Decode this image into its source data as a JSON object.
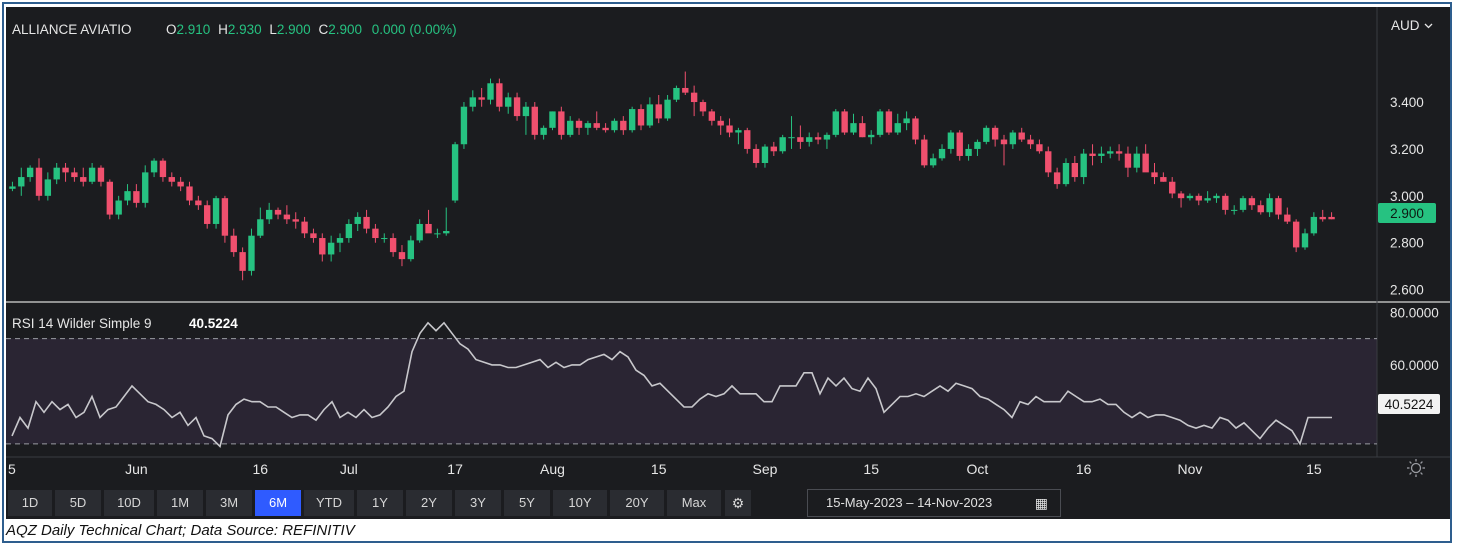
{
  "header": {
    "symbol": "ALLIANCE AVIATIO",
    "o_label": "O",
    "o_value": "2.910",
    "h_label": "H",
    "h_value": "2.930",
    "l_label": "L",
    "l_value": "2.900",
    "c_label": "C",
    "c_value": "2.900",
    "change": "0.000 (0.00%)",
    "currency": "AUD",
    "last_price_tag": "2.900"
  },
  "rsi_header": {
    "label": "RSI 14 Wilder Simple 9",
    "value": "40.5224",
    "last_tag": "40.5224"
  },
  "ranges": [
    "1D",
    "5D",
    "10D",
    "1M",
    "3M",
    "6M",
    "YTD",
    "1Y",
    "2Y",
    "3Y",
    "5Y",
    "10Y",
    "20Y",
    "Max"
  ],
  "active_range": "6M",
  "date_range": {
    "from": "15-May-2023",
    "sep": "–",
    "to": "14-Nov-2023"
  },
  "caption": "AQZ Daily Technical Chart; Data Source: REFINITIV",
  "colors": {
    "up": "#26c281",
    "down": "#f0506e",
    "rsi_line": "#c8c8cc",
    "bg": "#1b1c1f",
    "rsi_band": "#2a2533",
    "accent": "#2f5bff"
  },
  "icons": {
    "settings": "gear-icon",
    "calendar": "calendar-icon",
    "chevron": "chevron-down-icon",
    "chart_settings": "sun-gear-icon"
  },
  "chart_data": [
    {
      "type": "candlestick",
      "title": "ALLIANCE AVIATIO",
      "ylabel": "AUD",
      "ylim": [
        2.56,
        3.72
      ],
      "y_ticks": [
        "3.400",
        "3.200",
        "3.000",
        "2.800",
        "2.600"
      ],
      "x_ticks": [
        "5",
        "Jun",
        "16",
        "Jul",
        "17",
        "Aug",
        "15",
        "Sep",
        "15",
        "Oct",
        "16",
        "Nov",
        "15"
      ],
      "ohlc": [
        [
          3.03,
          3.06,
          3.02,
          3.04
        ],
        [
          3.04,
          3.12,
          3.0,
          3.08
        ],
        [
          3.08,
          3.13,
          3.06,
          3.12
        ],
        [
          3.12,
          3.16,
          2.98,
          3.0
        ],
        [
          3.0,
          3.1,
          2.98,
          3.07
        ],
        [
          3.07,
          3.14,
          3.05,
          3.12
        ],
        [
          3.12,
          3.14,
          3.06,
          3.1
        ],
        [
          3.1,
          3.12,
          3.06,
          3.08
        ],
        [
          3.08,
          3.12,
          3.04,
          3.06
        ],
        [
          3.06,
          3.14,
          3.05,
          3.12
        ],
        [
          3.12,
          3.13,
          3.04,
          3.06
        ],
        [
          3.06,
          3.07,
          2.9,
          2.92
        ],
        [
          2.92,
          3.0,
          2.9,
          2.98
        ],
        [
          2.98,
          3.05,
          2.96,
          3.02
        ],
        [
          3.02,
          3.05,
          2.95,
          2.97
        ],
        [
          2.97,
          3.13,
          2.95,
          3.1
        ],
        [
          3.1,
          3.16,
          3.08,
          3.15
        ],
        [
          3.15,
          3.16,
          3.06,
          3.08
        ],
        [
          3.08,
          3.1,
          3.04,
          3.06
        ],
        [
          3.06,
          3.08,
          3.02,
          3.04
        ],
        [
          3.04,
          3.06,
          2.96,
          2.98
        ],
        [
          2.98,
          3.0,
          2.94,
          2.96
        ],
        [
          2.96,
          2.98,
          2.86,
          2.88
        ],
        [
          2.88,
          3.0,
          2.86,
          2.99
        ],
        [
          2.99,
          3.0,
          2.8,
          2.83
        ],
        [
          2.83,
          2.86,
          2.74,
          2.76
        ],
        [
          2.76,
          2.78,
          2.64,
          2.68
        ],
        [
          2.68,
          2.86,
          2.66,
          2.83
        ],
        [
          2.83,
          2.95,
          2.82,
          2.9
        ],
        [
          2.9,
          2.97,
          2.88,
          2.94
        ],
        [
          2.94,
          2.95,
          2.9,
          2.92
        ],
        [
          2.92,
          2.96,
          2.88,
          2.9
        ],
        [
          2.9,
          2.93,
          2.86,
          2.89
        ],
        [
          2.89,
          2.91,
          2.82,
          2.84
        ],
        [
          2.84,
          2.86,
          2.8,
          2.82
        ],
        [
          2.82,
          2.84,
          2.72,
          2.75
        ],
        [
          2.75,
          2.83,
          2.72,
          2.8
        ],
        [
          2.8,
          2.84,
          2.76,
          2.82
        ],
        [
          2.82,
          2.9,
          2.8,
          2.88
        ],
        [
          2.88,
          2.93,
          2.85,
          2.91
        ],
        [
          2.91,
          2.94,
          2.84,
          2.86
        ],
        [
          2.86,
          2.88,
          2.8,
          2.82
        ],
        [
          2.82,
          2.84,
          2.8,
          2.82
        ],
        [
          2.82,
          2.84,
          2.74,
          2.76
        ],
        [
          2.76,
          2.79,
          2.7,
          2.73
        ],
        [
          2.73,
          2.83,
          2.72,
          2.81
        ],
        [
          2.81,
          2.9,
          2.8,
          2.88
        ],
        [
          2.88,
          2.94,
          2.85,
          2.84
        ],
        [
          2.84,
          2.86,
          2.82,
          2.84
        ],
        [
          2.84,
          2.95,
          2.83,
          2.85
        ],
        [
          2.98,
          3.23,
          2.97,
          3.22
        ],
        [
          3.22,
          3.4,
          3.2,
          3.38
        ],
        [
          3.38,
          3.45,
          3.36,
          3.42
        ],
        [
          3.42,
          3.46,
          3.38,
          3.41
        ],
        [
          3.41,
          3.5,
          3.39,
          3.48
        ],
        [
          3.48,
          3.5,
          3.36,
          3.38
        ],
        [
          3.38,
          3.44,
          3.35,
          3.42
        ],
        [
          3.42,
          3.44,
          3.32,
          3.34
        ],
        [
          3.34,
          3.4,
          3.26,
          3.38
        ],
        [
          3.38,
          3.4,
          3.24,
          3.26
        ],
        [
          3.26,
          3.3,
          3.24,
          3.29
        ],
        [
          3.29,
          3.36,
          3.28,
          3.36
        ],
        [
          3.36,
          3.38,
          3.24,
          3.26
        ],
        [
          3.26,
          3.34,
          3.25,
          3.32
        ],
        [
          3.32,
          3.33,
          3.26,
          3.29
        ],
        [
          3.29,
          3.32,
          3.26,
          3.31
        ],
        [
          3.31,
          3.36,
          3.28,
          3.29
        ],
        [
          3.29,
          3.31,
          3.27,
          3.28
        ],
        [
          3.28,
          3.33,
          3.27,
          3.32
        ],
        [
          3.32,
          3.34,
          3.26,
          3.28
        ],
        [
          3.28,
          3.38,
          3.27,
          3.37
        ],
        [
          3.37,
          3.39,
          3.28,
          3.3
        ],
        [
          3.3,
          3.42,
          3.29,
          3.39
        ],
        [
          3.39,
          3.43,
          3.31,
          3.33
        ],
        [
          3.33,
          3.43,
          3.32,
          3.41
        ],
        [
          3.41,
          3.47,
          3.4,
          3.46
        ],
        [
          3.46,
          3.53,
          3.43,
          3.44
        ],
        [
          3.44,
          3.47,
          3.34,
          3.4
        ],
        [
          3.4,
          3.41,
          3.34,
          3.36
        ],
        [
          3.36,
          3.37,
          3.3,
          3.32
        ],
        [
          3.32,
          3.34,
          3.26,
          3.3
        ],
        [
          3.3,
          3.33,
          3.25,
          3.27
        ],
        [
          3.27,
          3.29,
          3.22,
          3.28
        ],
        [
          3.28,
          3.29,
          3.18,
          3.2
        ],
        [
          3.2,
          3.22,
          3.12,
          3.14
        ],
        [
          3.14,
          3.22,
          3.12,
          3.21
        ],
        [
          3.21,
          3.23,
          3.17,
          3.19
        ],
        [
          3.19,
          3.26,
          3.18,
          3.25
        ],
        [
          3.25,
          3.34,
          3.2,
          3.25
        ],
        [
          3.25,
          3.3,
          3.2,
          3.23
        ],
        [
          3.23,
          3.27,
          3.21,
          3.25
        ],
        [
          3.25,
          3.27,
          3.22,
          3.24
        ],
        [
          3.24,
          3.27,
          3.2,
          3.26
        ],
        [
          3.26,
          3.37,
          3.25,
          3.36
        ],
        [
          3.36,
          3.37,
          3.26,
          3.27
        ],
        [
          3.27,
          3.35,
          3.26,
          3.31
        ],
        [
          3.31,
          3.34,
          3.25,
          3.25
        ],
        [
          3.25,
          3.28,
          3.22,
          3.26
        ],
        [
          3.26,
          3.37,
          3.25,
          3.36
        ],
        [
          3.36,
          3.37,
          3.26,
          3.27
        ],
        [
          3.27,
          3.35,
          3.26,
          3.31
        ],
        [
          3.31,
          3.36,
          3.28,
          3.33
        ],
        [
          3.33,
          3.34,
          3.22,
          3.24
        ],
        [
          3.24,
          3.26,
          3.12,
          3.13
        ],
        [
          3.13,
          3.18,
          3.12,
          3.16
        ],
        [
          3.16,
          3.22,
          3.15,
          3.2
        ],
        [
          3.2,
          3.28,
          3.18,
          3.27
        ],
        [
          3.27,
          3.28,
          3.15,
          3.17
        ],
        [
          3.17,
          3.22,
          3.15,
          3.2
        ],
        [
          3.2,
          3.24,
          3.17,
          3.23
        ],
        [
          3.23,
          3.3,
          3.22,
          3.29
        ],
        [
          3.29,
          3.3,
          3.21,
          3.24
        ],
        [
          3.24,
          3.26,
          3.13,
          3.22
        ],
        [
          3.22,
          3.28,
          3.2,
          3.27
        ],
        [
          3.27,
          3.29,
          3.23,
          3.24
        ],
        [
          3.24,
          3.26,
          3.2,
          3.22
        ],
        [
          3.22,
          3.24,
          3.18,
          3.19
        ],
        [
          3.19,
          3.21,
          3.08,
          3.1
        ],
        [
          3.1,
          3.12,
          3.03,
          3.05
        ],
        [
          3.05,
          3.16,
          3.04,
          3.14
        ],
        [
          3.14,
          3.17,
          3.06,
          3.08
        ],
        [
          3.08,
          3.2,
          3.05,
          3.18
        ],
        [
          3.18,
          3.22,
          3.13,
          3.17
        ],
        [
          3.17,
          3.21,
          3.14,
          3.18
        ],
        [
          3.18,
          3.21,
          3.16,
          3.19
        ],
        [
          3.19,
          3.22,
          3.15,
          3.18
        ],
        [
          3.18,
          3.21,
          3.08,
          3.12
        ],
        [
          3.12,
          3.21,
          3.1,
          3.18
        ],
        [
          3.18,
          3.22,
          3.14,
          3.1
        ],
        [
          3.1,
          3.14,
          3.05,
          3.08
        ],
        [
          3.08,
          3.1,
          3.06,
          3.06
        ],
        [
          3.06,
          3.08,
          2.99,
          3.01
        ],
        [
          3.01,
          3.02,
          2.95,
          2.99
        ],
        [
          2.99,
          3.01,
          2.98,
          3.0
        ],
        [
          3.0,
          3.01,
          2.96,
          2.98
        ],
        [
          2.98,
          3.02,
          2.97,
          2.99
        ],
        [
          2.99,
          3.01,
          2.97,
          3.0
        ],
        [
          3.0,
          3.01,
          2.92,
          2.94
        ],
        [
          2.94,
          2.96,
          2.92,
          2.94
        ],
        [
          2.94,
          3.0,
          2.93,
          2.99
        ],
        [
          2.99,
          3.0,
          2.94,
          2.96
        ],
        [
          2.96,
          2.98,
          2.92,
          2.93
        ],
        [
          2.93,
          3.01,
          2.91,
          2.99
        ],
        [
          2.99,
          3.0,
          2.9,
          2.92
        ],
        [
          2.92,
          2.95,
          2.88,
          2.89
        ],
        [
          2.89,
          2.9,
          2.76,
          2.78
        ],
        [
          2.78,
          2.86,
          2.77,
          2.84
        ],
        [
          2.84,
          2.93,
          2.83,
          2.91
        ],
        [
          2.91,
          2.94,
          2.89,
          2.9
        ],
        [
          2.91,
          2.93,
          2.9,
          2.9
        ]
      ]
    },
    {
      "type": "line",
      "title": "RSI 14 Wilder Simple 9",
      "ylim": [
        25,
        82
      ],
      "y_ticks": [
        "80.0000",
        "60.0000"
      ],
      "reference_lines": [
        70,
        30
      ],
      "series": [
        {
          "name": "RSI 14 Wilder Simple 9",
          "values": [
            33,
            40,
            36,
            46,
            42,
            46,
            43,
            45,
            40,
            42,
            48,
            40,
            43,
            44,
            48,
            52,
            49,
            46,
            45,
            43,
            40,
            42,
            37,
            40,
            33,
            32,
            29,
            41,
            45,
            47,
            46,
            46,
            44,
            44,
            42,
            40,
            41,
            41,
            39,
            43,
            46,
            40,
            42,
            40,
            43,
            40,
            41,
            44,
            48,
            50,
            65,
            72,
            76,
            73,
            76,
            72,
            68,
            66,
            62,
            61,
            60,
            60,
            59,
            59,
            60,
            61,
            62,
            59,
            61,
            59,
            60,
            60,
            62,
            63,
            64,
            62,
            65,
            63,
            58,
            56,
            52,
            53,
            50,
            47,
            44,
            44,
            47,
            49,
            48,
            49,
            52,
            49,
            49,
            49,
            46,
            46,
            52,
            52,
            52,
            57,
            57,
            49,
            55,
            52,
            55,
            51,
            50,
            55,
            51,
            42,
            45,
            48,
            48,
            49,
            48,
            50,
            52,
            50,
            53,
            52,
            51,
            48,
            47,
            45,
            43,
            40,
            46,
            45,
            48,
            46,
            46,
            46,
            50,
            48,
            46,
            46,
            47,
            45,
            45,
            42,
            40,
            42,
            40,
            41,
            41,
            40,
            39,
            37,
            36,
            37,
            36,
            40,
            39,
            36,
            38,
            35,
            32,
            36,
            39,
            37,
            35,
            30,
            40,
            40,
            40,
            40
          ]
        }
      ]
    }
  ]
}
